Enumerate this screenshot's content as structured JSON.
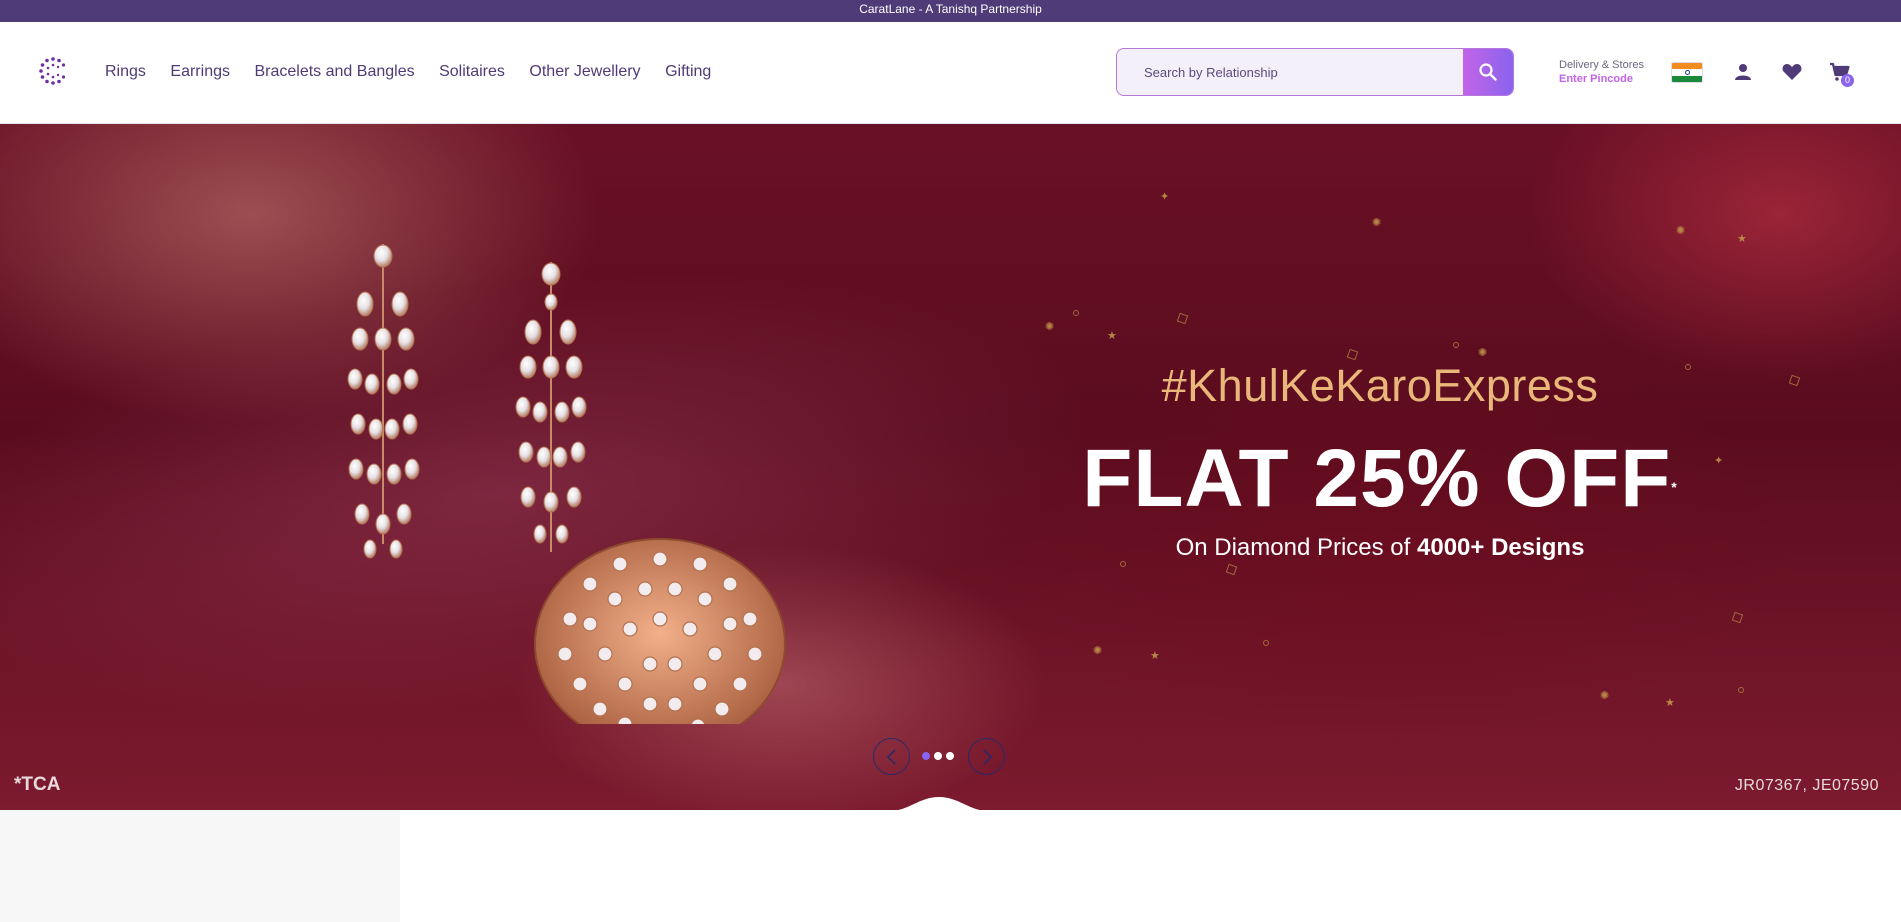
{
  "topbar": {
    "text": "CaratLane - A Tanishq Partnership"
  },
  "nav": {
    "items": [
      {
        "label": "Rings"
      },
      {
        "label": "Earrings"
      },
      {
        "label": "Bracelets and Bangles"
      },
      {
        "label": "Solitaires"
      },
      {
        "label": "Other Jewellery"
      },
      {
        "label": "Gifting"
      }
    ]
  },
  "search": {
    "placeholder": "Search by Relationship",
    "icon": "search-icon"
  },
  "delivery": {
    "line1": "Delivery & Stores",
    "line2": "Enter Pincode"
  },
  "header_icons": {
    "flag": "india-flag-icon",
    "account": "user-icon",
    "wishlist": "heart-icon",
    "cart": "cart-icon",
    "cart_count": "0"
  },
  "hero": {
    "hashtag": "#KhulKeKaroExpress",
    "offer": "FLAT 25% OFF",
    "offer_mark": "*",
    "sub_prefix": "On Diamond Prices of ",
    "sub_bold": "4000+ Designs",
    "tca": "*TCA",
    "codes": "JR07367, JE07590",
    "slides": 3,
    "active_slide": 1
  },
  "colors": {
    "brand": "#4f3b78",
    "accent": "#8a63ee",
    "pink": "#c364e8",
    "gold": "#e9b77a"
  }
}
